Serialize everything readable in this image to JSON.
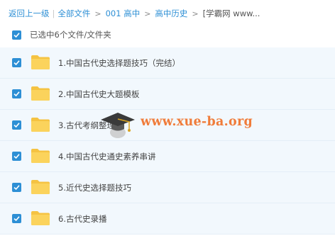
{
  "breadcrumb": {
    "back": "返回上一级",
    "all_files": "全部文件",
    "level1": "001 高中",
    "level2": "高中历史",
    "current": "[学霸网 www..."
  },
  "selection": {
    "summary": "已选中6个文件/文件夹"
  },
  "files": [
    {
      "name": "1.中国古代史选择题技巧（完结）"
    },
    {
      "name": "2.中国古代史大题模板"
    },
    {
      "name": "3.古代考纲整理"
    },
    {
      "name": "4.中国古代史通史素养串讲"
    },
    {
      "name": "5.近代史选择题技巧"
    },
    {
      "name": "6.古代史录播"
    }
  ],
  "watermark": {
    "text": "www.xue-ba.org",
    "icon": "graduation-cap-icon"
  },
  "colors": {
    "accent": "#2d8fd5",
    "row_background": "#f2f8fd",
    "folder": "#f5c342",
    "watermark": "#f07c3a"
  }
}
